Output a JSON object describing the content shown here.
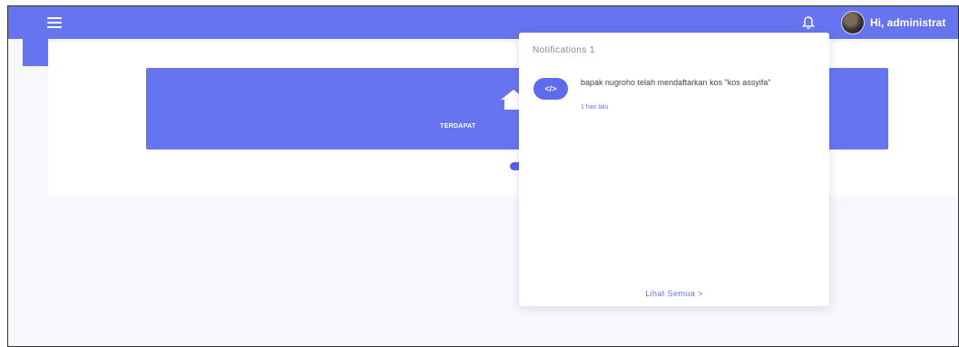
{
  "header": {
    "menu_icon": "hamburger-icon",
    "bell_icon": "bell-icon",
    "user_greeting": "Hi, administrat"
  },
  "hero": {
    "icon": "house-icon",
    "text": "TERDAPAT"
  },
  "notifications": {
    "title": "Notifications 1",
    "items": [
      {
        "icon": "code-icon",
        "icon_glyph": "</>",
        "message": "bapak nugroho telah mendaftarkan kos \"kos assyifa\"",
        "time": "1 hari lalu"
      }
    ],
    "footer_label": "Lihat Semua  >"
  },
  "colors": {
    "accent": "#6674f0",
    "background": "#f7f8fc"
  }
}
